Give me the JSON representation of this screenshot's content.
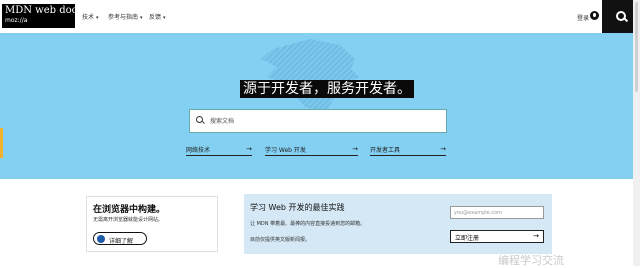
{
  "header": {
    "logo_line1": "MDN web docs",
    "logo_line2": "moz://a",
    "nav": [
      {
        "label": "技术"
      },
      {
        "label": "参考与指南"
      },
      {
        "label": "反馈"
      }
    ],
    "login": "登录",
    "search_icon": "search-icon",
    "github_icon": "github-icon"
  },
  "hero": {
    "tagline": "源于开发者，服务开发者。",
    "search_placeholder": "搜索文档",
    "quick_links": [
      {
        "label": "网络技术"
      },
      {
        "label": "学习 Web 开发"
      },
      {
        "label": "开发者工具"
      }
    ],
    "colors": {
      "hero_bg": "#83d0f2",
      "accent": "#f2b230"
    }
  },
  "browser_card": {
    "title": "在浏览器中构建。",
    "desc": "无需离开浏览器就能设计网站。",
    "button": "详细了解"
  },
  "newsletter": {
    "title": "学习 Web 开发的最佳实践",
    "desc1": "让 MDN 带着最、最棒的内容直接投递到您的邮箱。",
    "desc2": "目前仅提供英文版新闻报。",
    "email_placeholder": "you@example.com",
    "subscribe": "立即注册",
    "bg": "#d5e8f5"
  },
  "watermark": "编程学习交流"
}
